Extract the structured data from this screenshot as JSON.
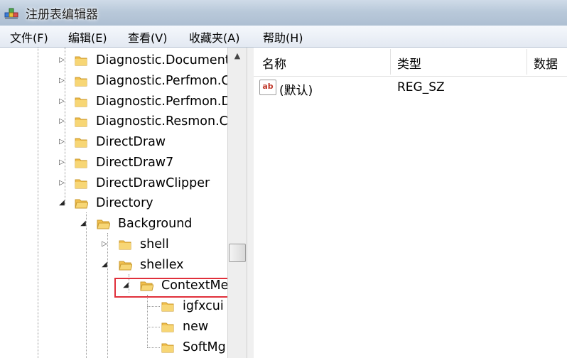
{
  "window": {
    "title": "注册表编辑器",
    "app_icon": "regedit-icon"
  },
  "menu": [
    "文件(F)",
    "编辑(E)",
    "查看(V)",
    "收藏夹(A)",
    "帮助(H)"
  ],
  "tree": {
    "nodes": [
      {
        "label": "Diagnostic.Document",
        "expanded": false
      },
      {
        "label": "Diagnostic.Perfmon.C",
        "expanded": false
      },
      {
        "label": "Diagnostic.Perfmon.D",
        "expanded": false
      },
      {
        "label": "Diagnostic.Resmon.C",
        "expanded": false
      },
      {
        "label": "DirectDraw",
        "expanded": false
      },
      {
        "label": "DirectDraw7",
        "expanded": false
      },
      {
        "label": "DirectDrawClipper",
        "expanded": false
      },
      {
        "label": "Directory",
        "expanded": true
      },
      {
        "label": "Background",
        "expanded": true
      },
      {
        "label": "shell",
        "expanded": false
      },
      {
        "label": "shellex",
        "expanded": true
      },
      {
        "label": "ContextMe",
        "expanded": true,
        "highlighted": true
      },
      {
        "label": "igfxcui"
      },
      {
        "label": "new"
      },
      {
        "label": "SoftMg"
      }
    ]
  },
  "columns": {
    "name": "名称",
    "type": "类型",
    "data": "数据"
  },
  "values": [
    {
      "name": "(默认)",
      "type": "REG_SZ",
      "icon": "string-value-icon",
      "icon_text": "ab"
    }
  ],
  "colors": {
    "highlight": "#e0303b",
    "folder": "#f2c04e"
  }
}
